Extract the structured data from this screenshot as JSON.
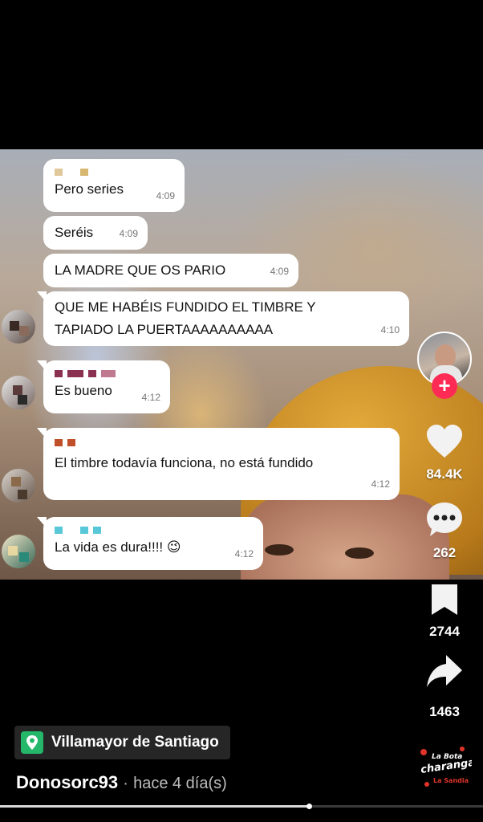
{
  "chat": {
    "messages": [
      {
        "text": "Pero series",
        "time": "4:09"
      },
      {
        "text": "Seréis",
        "time": "4:09"
      },
      {
        "text": "LA MADRE QUE OS PARIO",
        "time": "4:09"
      },
      {
        "text_line1": "QUE ME HABÉIS FUNDIDO EL TIMBRE Y",
        "text_line2": "TAPIADO LA PUERTAAAAAAAAAA",
        "time": "4:10"
      },
      {
        "text": "Es bueno",
        "time": "4:12"
      },
      {
        "text": "El timbre todavía funciona, no está fundido",
        "time": "4:12"
      },
      {
        "text": "La vida es dura!!!! ",
        "emoji": "😉",
        "time": "4:12"
      }
    ]
  },
  "actions": {
    "likes": "84.4K",
    "comments": "262",
    "saves": "2744",
    "shares": "1463"
  },
  "post": {
    "location": "Villamayor de Santiago",
    "username": "Donosorc93",
    "separator": "·",
    "time_ago": "hace 4 día(s)"
  },
  "sound_logo": {
    "line1": "La Bota",
    "line2": "charanga",
    "line3": "La Sandia"
  },
  "playback": {
    "progress": 0.64
  },
  "colors": {
    "follow_plus": "#fe2c55",
    "location_pin": "#25b86b",
    "beanie": "#d79a2a"
  }
}
